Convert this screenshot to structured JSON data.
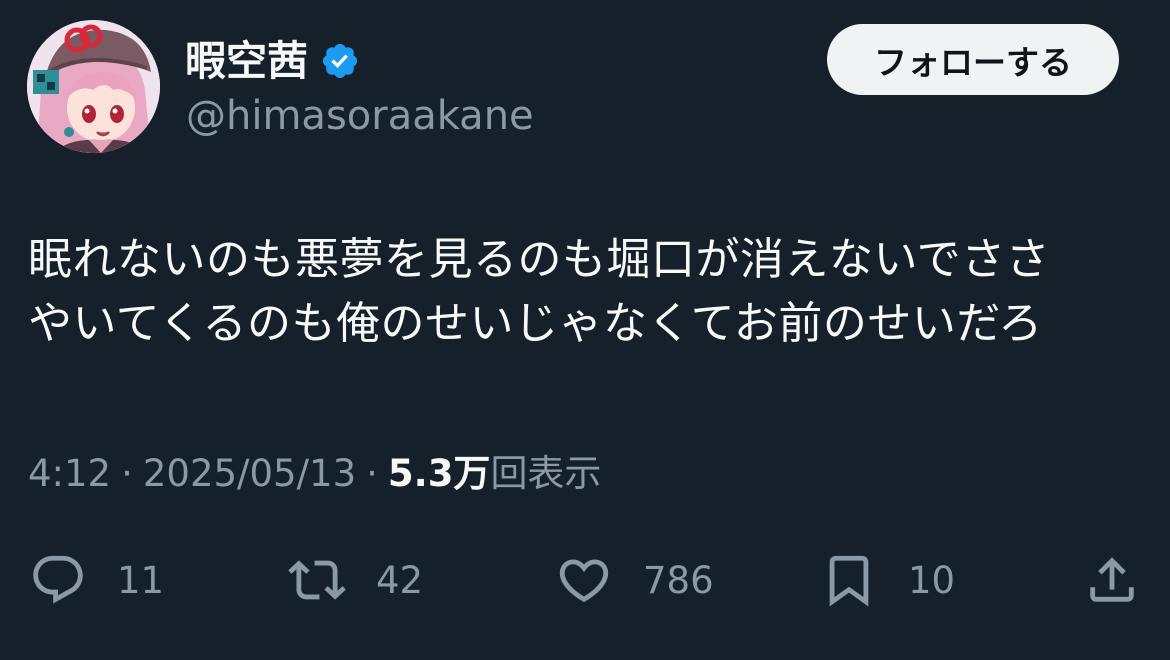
{
  "user": {
    "display_name": "暇空茜",
    "handle": "@himasoraakane",
    "verified": true,
    "verified_color": "#1d9bf0"
  },
  "follow_button": {
    "label": "フォローする"
  },
  "tweet": {
    "text": "眠れないのも悪夢を見るのも堀口が消えないでささ\nやいてくるのも俺のせいじゃなくてお前のせいだろ"
  },
  "meta": {
    "time": "4:12",
    "separator": "·",
    "date": "2025/05/13",
    "views_count": "5.3万",
    "views_label": "回表示"
  },
  "actions": {
    "reply": {
      "icon": "reply-icon",
      "count": "11"
    },
    "retweet": {
      "icon": "retweet-icon",
      "count": "42"
    },
    "like": {
      "icon": "heart-icon",
      "count": "786"
    },
    "bookmark": {
      "icon": "bookmark-icon",
      "count": "10"
    },
    "share": {
      "icon": "share-icon"
    }
  },
  "colors": {
    "background": "#15202b",
    "text_primary": "#f7f9f9",
    "text_secondary": "#8b98a5",
    "button_bg": "#eff3f4"
  }
}
